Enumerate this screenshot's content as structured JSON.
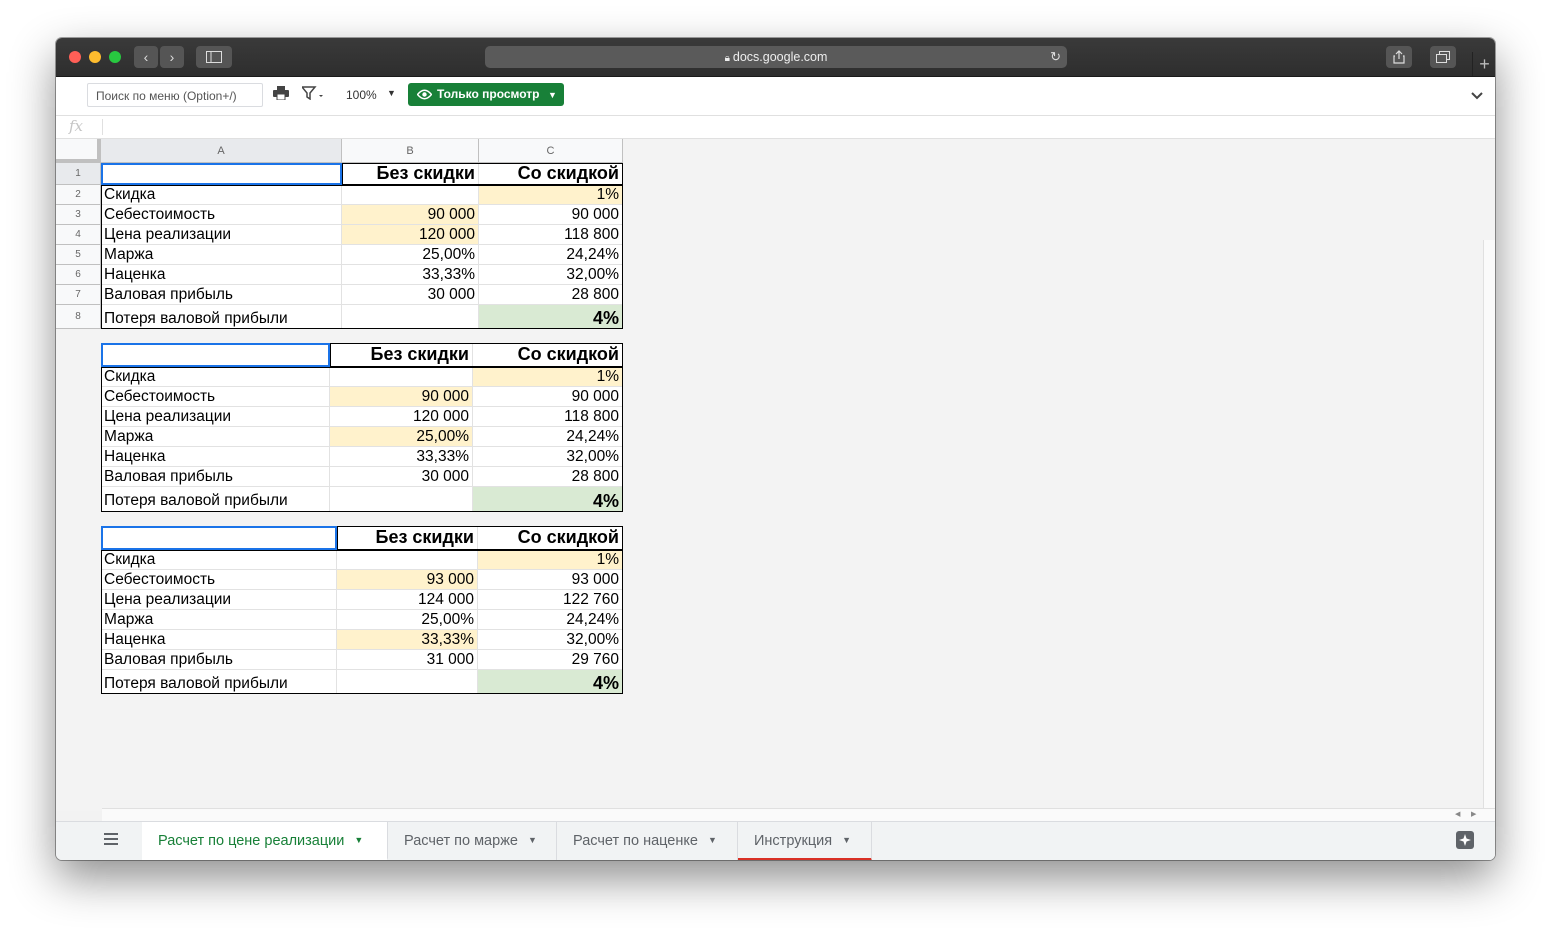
{
  "browser": {
    "url": "docs.google.com",
    "back": "‹",
    "forward": "›",
    "new_tab": "+"
  },
  "toolbar": {
    "menu_search_placeholder": "Поиск по меню (Option+/)",
    "zoom": "100%",
    "view_only": "Только просмотр"
  },
  "formula_bar": {
    "fx": "fx"
  },
  "columns": [
    "A",
    "B",
    "C"
  ],
  "rows": [
    "1",
    "2",
    "3",
    "4",
    "5",
    "6",
    "7",
    "8"
  ],
  "tables": [
    {
      "header": [
        "",
        "Без скидки",
        "Со скидкой"
      ],
      "rows": [
        [
          "Скидка",
          "",
          "1%"
        ],
        [
          "Себестоимость",
          "90 000",
          "90 000"
        ],
        [
          "Цена реализации",
          "120 000",
          "118 800"
        ],
        [
          "Маржа",
          "25,00%",
          "24,24%"
        ],
        [
          "Наценка",
          "33,33%",
          "32,00%"
        ],
        [
          "Валовая прибыль",
          "30 000",
          "28 800"
        ],
        [
          "Потеря валовой прибыли",
          "",
          "4%"
        ]
      ]
    },
    {
      "header": [
        "",
        "Без скидки",
        "Со скидкой"
      ],
      "rows": [
        [
          "Скидка",
          "",
          "1%"
        ],
        [
          "Себестоимость",
          "90 000",
          "90 000"
        ],
        [
          "Цена реализации",
          "120 000",
          "118 800"
        ],
        [
          "Маржа",
          "25,00%",
          "24,24%"
        ],
        [
          "Наценка",
          "33,33%",
          "32,00%"
        ],
        [
          "Валовая прибыль",
          "30 000",
          "28 800"
        ],
        [
          "Потеря валовой прибыли",
          "",
          "4%"
        ]
      ]
    },
    {
      "header": [
        "",
        "Без скидки",
        "Со скидкой"
      ],
      "rows": [
        [
          "Скидка",
          "",
          "1%"
        ],
        [
          "Себестоимость",
          "93 000",
          "93 000"
        ],
        [
          "Цена реализации",
          "124 000",
          "122 760"
        ],
        [
          "Маржа",
          "25,00%",
          "24,24%"
        ],
        [
          "Наценка",
          "33,33%",
          "32,00%"
        ],
        [
          "Валовая прибыль",
          "31 000",
          "29 760"
        ],
        [
          "Потеря валовой прибыли",
          "",
          "4%"
        ]
      ]
    }
  ],
  "colors": {
    "input_highlight": "#fff2cc",
    "result_highlight": "#d9ead3",
    "active_tab": "#188038",
    "view_only_button": "#188038"
  },
  "sheet_tabs": [
    {
      "label": "Расчет по цене реализации",
      "active": true
    },
    {
      "label": "Расчет по марже",
      "active": false
    },
    {
      "label": "Расчет по наценке",
      "active": false
    },
    {
      "label": "Инструкция",
      "active": false
    }
  ]
}
